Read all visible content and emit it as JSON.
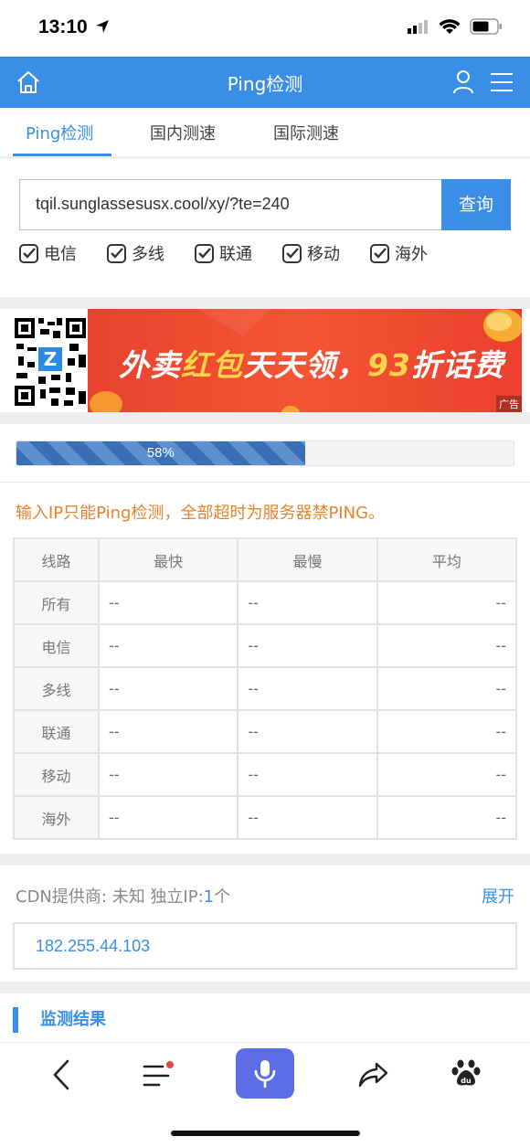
{
  "status_bar": {
    "time": "13:10"
  },
  "header": {
    "title": "Ping检测"
  },
  "tabs": [
    {
      "label": "Ping检测",
      "active": true
    },
    {
      "label": "国内测速",
      "active": false
    },
    {
      "label": "国际测速",
      "active": false
    }
  ],
  "search": {
    "value": "tqil.sunglassesusx.cool/xy/?te=240",
    "button_label": "查询"
  },
  "filters": [
    {
      "label": "电信",
      "checked": true
    },
    {
      "label": "多线",
      "checked": true
    },
    {
      "label": "联通",
      "checked": true
    },
    {
      "label": "移动",
      "checked": true
    },
    {
      "label": "海外",
      "checked": true
    }
  ],
  "ad": {
    "text_part1": "外卖",
    "text_highlight1": "红包",
    "text_part2": "天天领，",
    "text_highlight2": "93",
    "text_part3": "折话费",
    "tag": "广告"
  },
  "progress": {
    "percent": 58,
    "label": "58%"
  },
  "notice": "输入IP只能Ping检测，全部超时为服务器禁PING。",
  "table": {
    "headers": [
      "线路",
      "最快",
      "最慢",
      "平均"
    ],
    "rows": [
      [
        "所有",
        "--",
        "--",
        "--"
      ],
      [
        "电信",
        "--",
        "--",
        "--"
      ],
      [
        "多线",
        "--",
        "--",
        "--"
      ],
      [
        "联通",
        "--",
        "--",
        "--"
      ],
      [
        "移动",
        "--",
        "--",
        "--"
      ],
      [
        "海外",
        "--",
        "--",
        "--"
      ]
    ]
  },
  "cdn": {
    "provider_label": "CDN提供商:",
    "provider_value": "未知",
    "ip_label": "独立IP:",
    "ip_count": "1",
    "ip_unit": "个",
    "expand_label": "展开",
    "ip_address": "182.255.44.103"
  },
  "section_title": "监测结果",
  "colors": {
    "primary": "#3a8ee6",
    "notice": "#e8822d",
    "mic": "#5b6ee8"
  }
}
